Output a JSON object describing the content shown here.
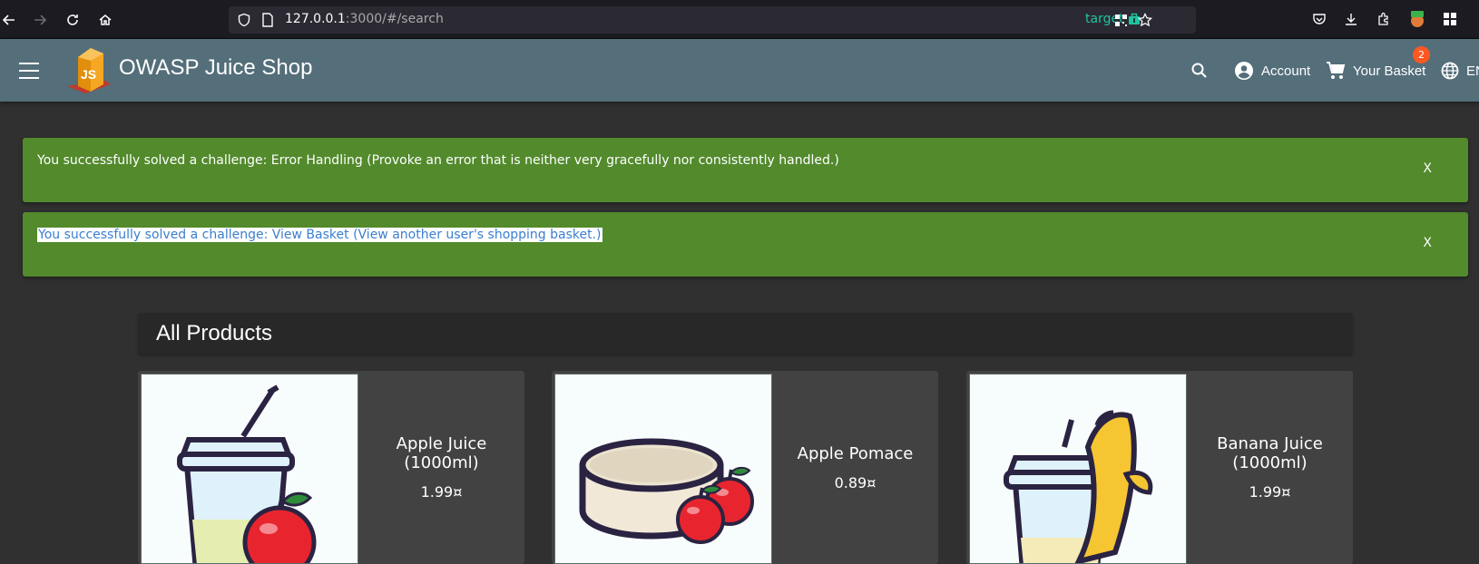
{
  "browser": {
    "url_host": "127.0.0.1",
    "url_rest": ":3000/#/search",
    "container_label": "target"
  },
  "app": {
    "title": "OWASP Juice Shop",
    "account_label": "Account",
    "basket_label": "Your Basket",
    "basket_count": "2",
    "language_label": "EN"
  },
  "notifications": [
    {
      "text": "You successfully solved a challenge: Error Handling (Provoke an error that is neither very gracefully nor consistently handled.)",
      "close": "X"
    },
    {
      "text": "You successfully solved a challenge: View Basket (View another user's shopping basket.)",
      "close": "X"
    }
  ],
  "products_section": {
    "title": "All Products",
    "items": [
      {
        "name": "Apple Juice (1000ml)",
        "price": "1.99¤"
      },
      {
        "name": "Apple Pomace",
        "price": "0.89¤"
      },
      {
        "name": "Banana Juice (1000ml)",
        "price": "1.99¤"
      }
    ]
  },
  "colors": {
    "toolbar": "#546e7a",
    "success": "#528a2c",
    "background": "#303030",
    "card": "#424242",
    "badge": "#ff5722"
  }
}
